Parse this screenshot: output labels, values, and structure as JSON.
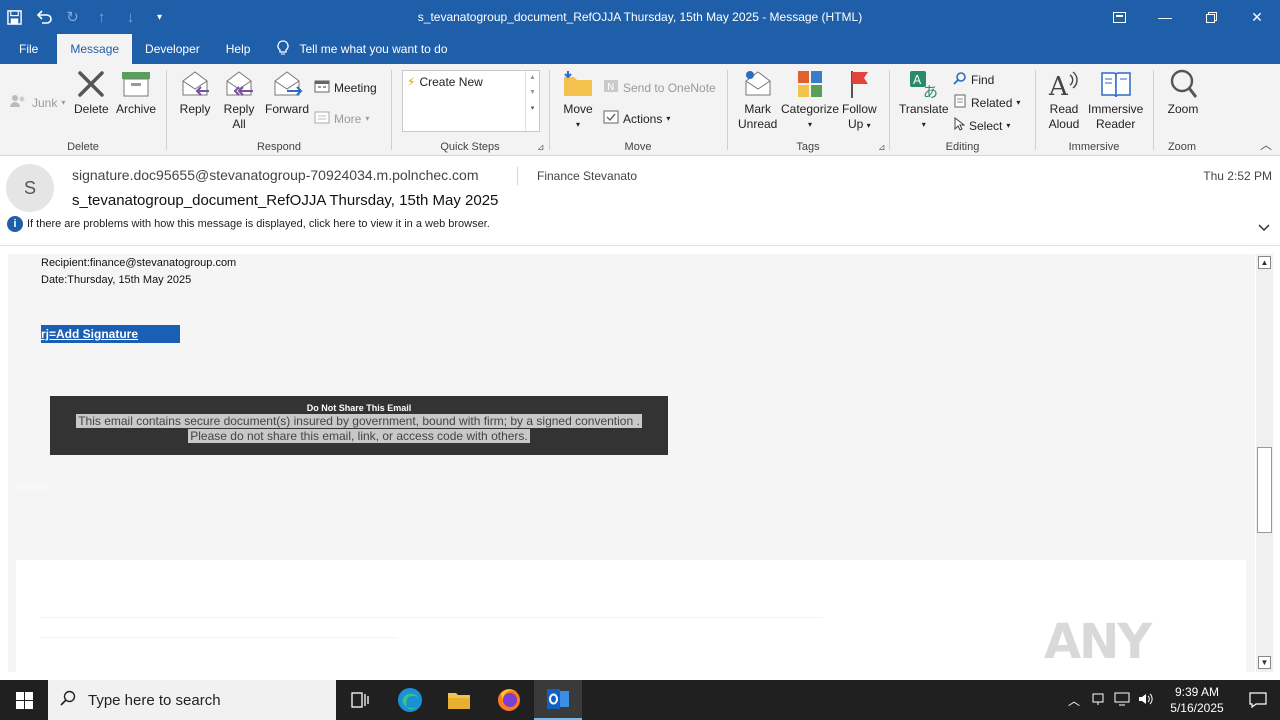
{
  "window": {
    "title": "s_tevanatogroup_document_RefOJJA Thursday, 15th May 2025  -  Message (HTML)"
  },
  "tabs": [
    "File",
    "Message",
    "Developer",
    "Help"
  ],
  "tell_me": "Tell me what you want to do",
  "ribbon": {
    "junk": "Junk",
    "delete": "Delete",
    "archive": "Archive",
    "group_delete": "Delete",
    "reply": "Reply",
    "reply_all_1": "Reply",
    "reply_all_2": "All",
    "forward": "Forward",
    "meeting": "Meeting",
    "more": "More",
    "group_respond": "Respond",
    "create_new": "Create New",
    "group_quick_steps": "Quick Steps",
    "move": "Move",
    "send_onenote": "Send to OneNote",
    "actions": "Actions",
    "group_move": "Move",
    "mark_unread_1": "Mark",
    "mark_unread_2": "Unread",
    "categorize": "Categorize",
    "follow_up_1": "Follow",
    "follow_up_2": "Up",
    "group_tags": "Tags",
    "translate": "Translate",
    "find": "Find",
    "related": "Related",
    "select": "Select",
    "group_editing": "Editing",
    "read_aloud_1": "Read",
    "read_aloud_2": "Aloud",
    "immersive_1": "Immersive",
    "immersive_2": "Reader",
    "group_immersive": "Immersive",
    "zoom": "Zoom",
    "group_zoom": "Zoom"
  },
  "message": {
    "avatar_letter": "S",
    "from": "signature.doc95655@stevanatogroup-70924034.m.polnchec.com",
    "to": "Finance Stevanato",
    "time": "Thu 2:52 PM",
    "subject": "s_tevanatogroup_document_RefOJJA Thursday, 15th May 2025",
    "info": "If there are problems with how this message is displayed, click here to view it in a web browser."
  },
  "body": {
    "recipient": "Recipient:finance@stevanatogroup.com",
    "date": "Date:Thursday, 15th May 2025",
    "signature_link": "rj=Add Signature",
    "banner_title": "Do Not Share This Email",
    "banner_line1": "This email contains secure document(s) insured by government, bound with firm; by a signed convention .",
    "banner_line2": "Please do not share this email, link, or access code with others.",
    "faint_text": "Never",
    "watermark": "ANY RUN"
  },
  "taskbar": {
    "search_placeholder": "Type here to search",
    "time": "9:39 AM",
    "date": "5/16/2025"
  },
  "colors": {
    "titlebar": "#1f5faa",
    "link_highlight": "#1a5fb4",
    "banner": "#333333"
  }
}
